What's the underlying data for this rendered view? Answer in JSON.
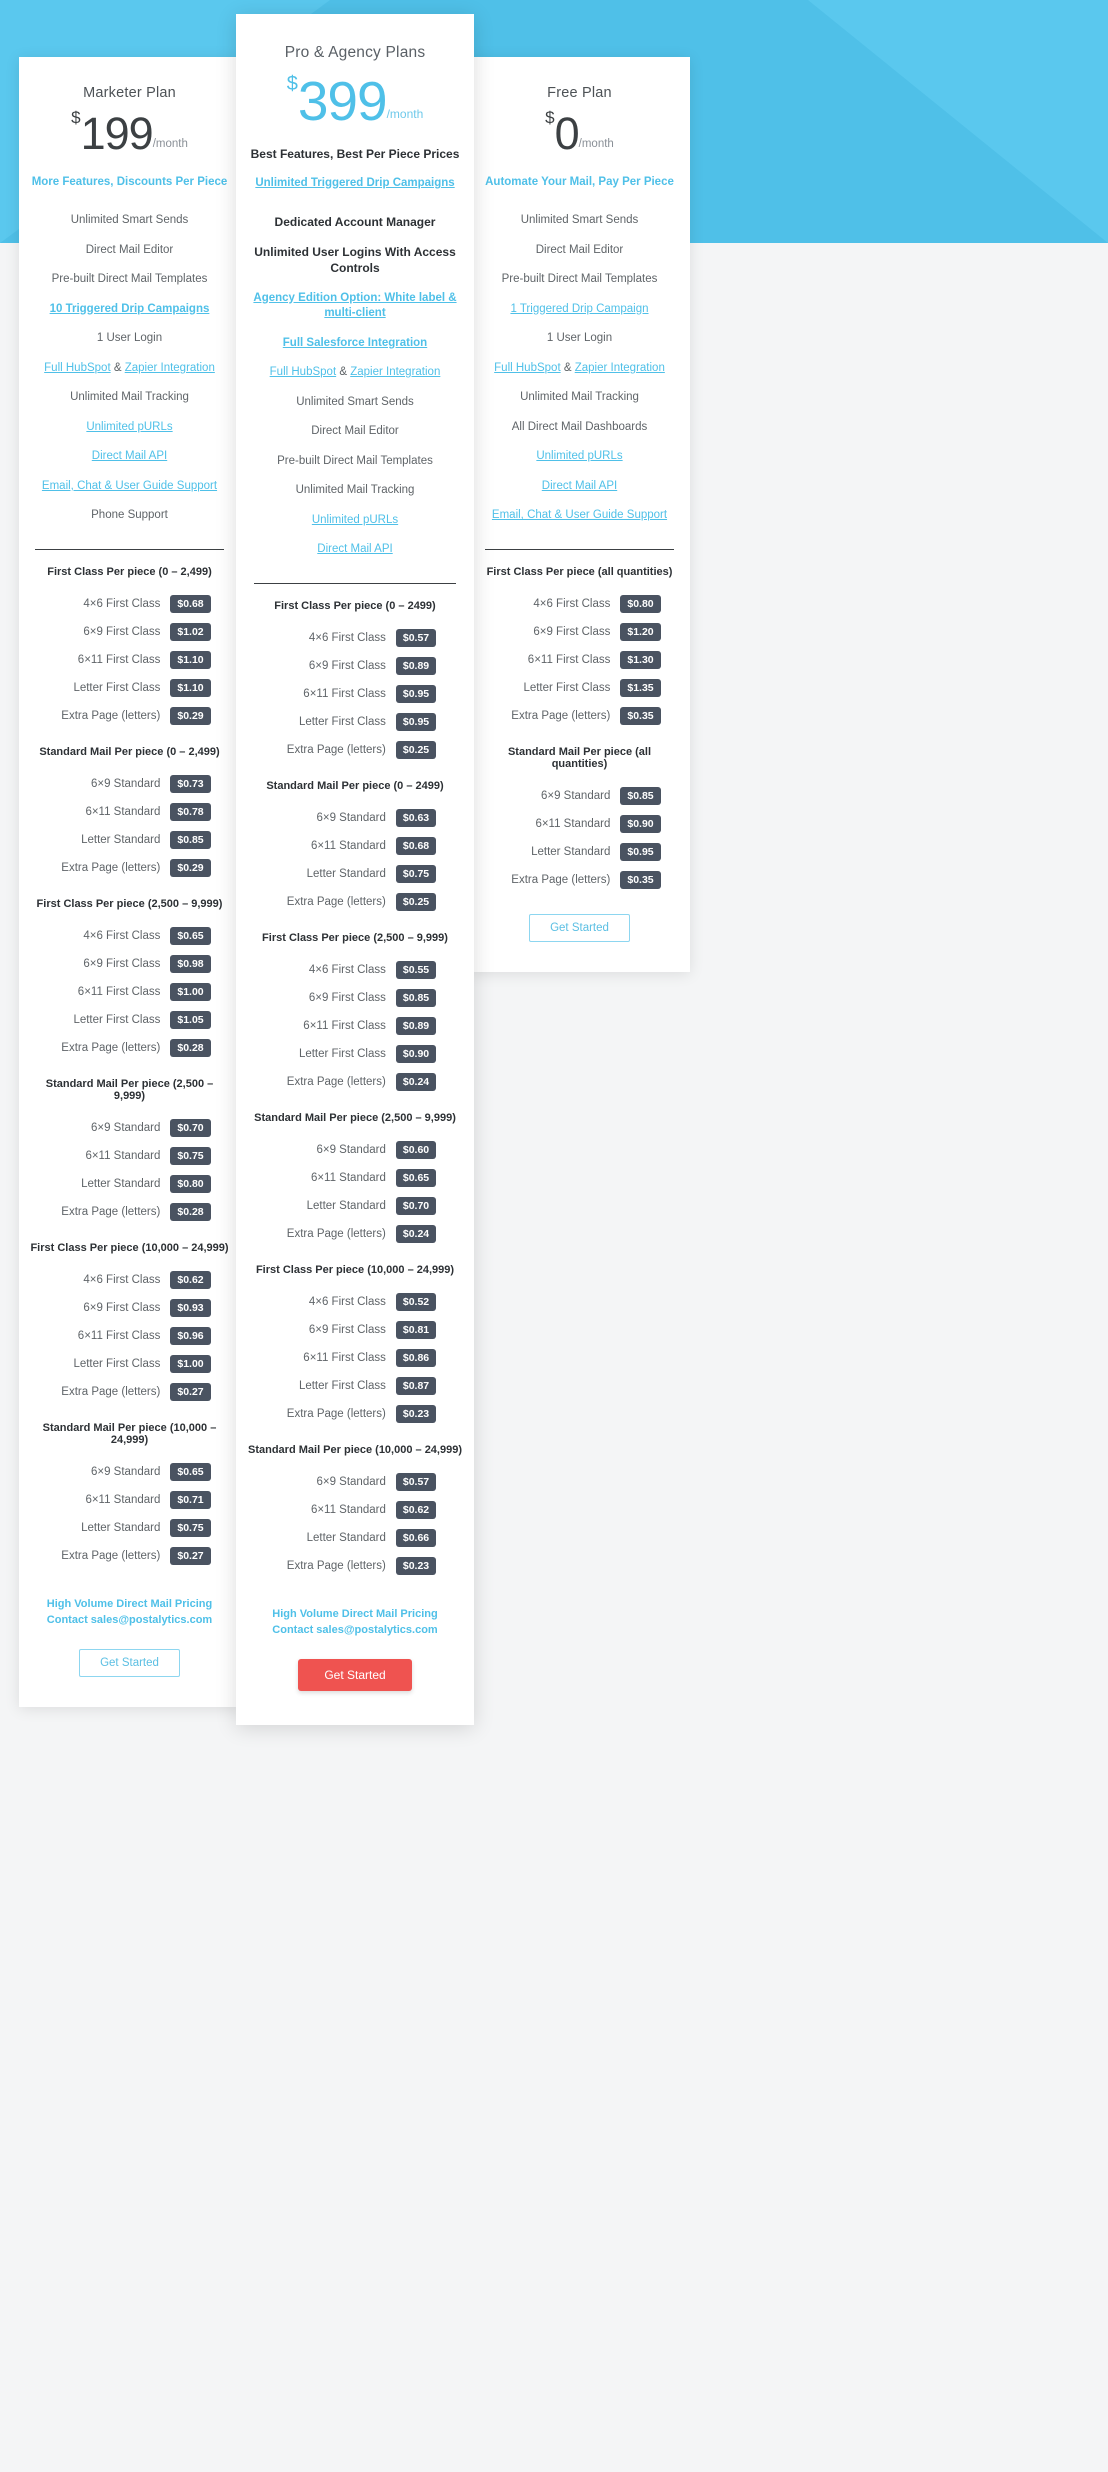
{
  "colors": {
    "banner": "#4fc0e8",
    "accent": "#4fc0e8",
    "badge": "#4a5361",
    "cta_solid": "#ef5350"
  },
  "marketer": {
    "plan_name": "Marketer Plan",
    "currency": "$",
    "amount": "199",
    "period": "/month",
    "tagline": "More Features, Discounts Per Piece",
    "features": [
      {
        "text": "Unlimited Smart Sends",
        "style": "plain"
      },
      {
        "text": "Direct Mail Editor",
        "style": "plain"
      },
      {
        "text": "Pre-built Direct Mail Templates",
        "style": "plain"
      },
      {
        "text": "10 Triggered Drip Campaigns",
        "style": "linkbold"
      },
      {
        "text": "1 User Login",
        "style": "plain"
      },
      {
        "text": "Full HubSpot & Zapier Integration",
        "style": "link-split"
      },
      {
        "text": "Unlimited Mail Tracking",
        "style": "plain"
      },
      {
        "text": "Unlimited pURLs",
        "style": "link"
      },
      {
        "text": "Direct Mail API",
        "style": "link"
      },
      {
        "text": "Email, Chat & User Guide Support",
        "style": "link"
      },
      {
        "text": "Phone Support",
        "style": "plain"
      }
    ],
    "tiers": [
      {
        "title": "First Class Per piece (0 – 2,499)",
        "rows": [
          {
            "label": "4×6 First Class",
            "price": "$0.68"
          },
          {
            "label": "6×9 First Class",
            "price": "$1.02"
          },
          {
            "label": "6×11 First Class",
            "price": "$1.10"
          },
          {
            "label": "Letter First Class",
            "price": "$1.10"
          },
          {
            "label": "Extra Page (letters)",
            "price": "$0.29"
          }
        ]
      },
      {
        "title": "Standard Mail Per piece (0 – 2,499)",
        "rows": [
          {
            "label": "6×9 Standard",
            "price": "$0.73"
          },
          {
            "label": "6×11 Standard",
            "price": "$0.78"
          },
          {
            "label": "Letter Standard",
            "price": "$0.85"
          },
          {
            "label": "Extra Page (letters)",
            "price": "$0.29"
          }
        ]
      },
      {
        "title": "First Class Per piece (2,500 – 9,999)",
        "rows": [
          {
            "label": "4×6 First Class",
            "price": "$0.65"
          },
          {
            "label": "6×9 First Class",
            "price": "$0.98"
          },
          {
            "label": "6×11 First Class",
            "price": "$1.00"
          },
          {
            "label": "Letter First Class",
            "price": "$1.05"
          },
          {
            "label": "Extra Page (letters)",
            "price": "$0.28"
          }
        ]
      },
      {
        "title": "Standard Mail Per piece (2,500 – 9,999)",
        "rows": [
          {
            "label": "6×9 Standard",
            "price": "$0.70"
          },
          {
            "label": "6×11 Standard",
            "price": "$0.75"
          },
          {
            "label": "Letter Standard",
            "price": "$0.80"
          },
          {
            "label": "Extra Page (letters)",
            "price": "$0.28"
          }
        ]
      },
      {
        "title": "First Class Per piece (10,000 – 24,999)",
        "rows": [
          {
            "label": "4×6 First Class",
            "price": "$0.62"
          },
          {
            "label": "6×9 First Class",
            "price": "$0.93"
          },
          {
            "label": "6×11 First Class",
            "price": "$0.96"
          },
          {
            "label": "Letter First Class",
            "price": "$1.00"
          },
          {
            "label": "Extra Page (letters)",
            "price": "$0.27"
          }
        ]
      },
      {
        "title": "Standard Mail Per piece (10,000 – 24,999)",
        "rows": [
          {
            "label": "6×9 Standard",
            "price": "$0.65"
          },
          {
            "label": "6×11 Standard",
            "price": "$0.71"
          },
          {
            "label": "Letter Standard",
            "price": "$0.75"
          },
          {
            "label": "Extra Page (letters)",
            "price": "$0.27"
          }
        ]
      }
    ],
    "contact_line1": "High Volume Direct Mail Pricing",
    "contact_line2": "Contact sales@postalytics.com",
    "cta_label": "Get Started"
  },
  "pro": {
    "plan_name": "Pro & Agency Plans",
    "currency": "$",
    "amount": "399",
    "period": "/month",
    "subhead": "Best Features, Best Per Piece Prices",
    "tagline": "Unlimited Triggered Drip Campaigns",
    "features": [
      {
        "text": "Dedicated Account Manager",
        "style": "bold"
      },
      {
        "text": "Unlimited User Logins With Access Controls",
        "style": "bold"
      },
      {
        "text": "Agency Edition Option: White label & multi-client",
        "style": "linkbold"
      },
      {
        "text": "Full Salesforce Integration",
        "style": "linkbold"
      },
      {
        "text": "Full HubSpot & Zapier Integration",
        "style": "link-split"
      },
      {
        "text": "Unlimited Smart Sends",
        "style": "plain"
      },
      {
        "text": "Direct Mail Editor",
        "style": "plain"
      },
      {
        "text": "Pre-built Direct Mail Templates",
        "style": "plain"
      },
      {
        "text": "Unlimited Mail Tracking",
        "style": "plain"
      },
      {
        "text": "Unlimited pURLs",
        "style": "link"
      },
      {
        "text": "Direct Mail API",
        "style": "link"
      }
    ],
    "tiers": [
      {
        "title": "First Class Per piece (0 – 2499)",
        "rows": [
          {
            "label": "4×6 First Class",
            "price": "$0.57"
          },
          {
            "label": "6×9 First Class",
            "price": "$0.89"
          },
          {
            "label": "6×11 First Class",
            "price": "$0.95"
          },
          {
            "label": "Letter First Class",
            "price": "$0.95"
          },
          {
            "label": "Extra Page (letters)",
            "price": "$0.25"
          }
        ]
      },
      {
        "title": "Standard Mail Per piece (0 – 2499)",
        "rows": [
          {
            "label": "6×9 Standard",
            "price": "$0.63"
          },
          {
            "label": "6×11 Standard",
            "price": "$0.68"
          },
          {
            "label": "Letter Standard",
            "price": "$0.75"
          },
          {
            "label": "Extra Page (letters)",
            "price": "$0.25"
          }
        ]
      },
      {
        "title": "First Class Per piece (2,500 – 9,999)",
        "rows": [
          {
            "label": "4×6 First Class",
            "price": "$0.55"
          },
          {
            "label": "6×9 First Class",
            "price": "$0.85"
          },
          {
            "label": "6×11 First Class",
            "price": "$0.89"
          },
          {
            "label": "Letter First Class",
            "price": "$0.90"
          },
          {
            "label": "Extra Page (letters)",
            "price": "$0.24"
          }
        ]
      },
      {
        "title": "Standard Mail Per piece (2,500 – 9,999)",
        "rows": [
          {
            "label": "6×9 Standard",
            "price": "$0.60"
          },
          {
            "label": "6×11 Standard",
            "price": "$0.65"
          },
          {
            "label": "Letter Standard",
            "price": "$0.70"
          },
          {
            "label": "Extra Page (letters)",
            "price": "$0.24"
          }
        ]
      },
      {
        "title": "First Class Per piece (10,000 – 24,999)",
        "rows": [
          {
            "label": "4×6 First Class",
            "price": "$0.52"
          },
          {
            "label": "6×9 First Class",
            "price": "$0.81"
          },
          {
            "label": "6×11 First Class",
            "price": "$0.86"
          },
          {
            "label": "Letter First Class",
            "price": "$0.87"
          },
          {
            "label": "Extra Page (letters)",
            "price": "$0.23"
          }
        ]
      },
      {
        "title": "Standard Mail Per piece (10,000 – 24,999)",
        "rows": [
          {
            "label": "6×9 Standard",
            "price": "$0.57"
          },
          {
            "label": "6×11 Standard",
            "price": "$0.62"
          },
          {
            "label": "Letter Standard",
            "price": "$0.66"
          },
          {
            "label": "Extra Page (letters)",
            "price": "$0.23"
          }
        ]
      }
    ],
    "contact_line1": "High Volume Direct Mail Pricing",
    "contact_line2": "Contact sales@postalytics.com",
    "cta_label": "Get Started"
  },
  "free": {
    "plan_name": "Free Plan",
    "currency": "$",
    "amount": "0",
    "period": "/month",
    "tagline": "Automate Your Mail, Pay Per Piece",
    "features": [
      {
        "text": "Unlimited Smart Sends",
        "style": "plain"
      },
      {
        "text": "Direct Mail Editor",
        "style": "plain"
      },
      {
        "text": "Pre-built Direct Mail Templates",
        "style": "plain"
      },
      {
        "text": "1 Triggered Drip Campaign",
        "style": "link"
      },
      {
        "text": "1 User Login",
        "style": "plain"
      },
      {
        "text": "Full HubSpot & Zapier Integration",
        "style": "link-split"
      },
      {
        "text": "Unlimited Mail Tracking",
        "style": "plain"
      },
      {
        "text": "All Direct Mail Dashboards",
        "style": "plain"
      },
      {
        "text": "Unlimited pURLs",
        "style": "link"
      },
      {
        "text": "Direct Mail API",
        "style": "link"
      },
      {
        "text": "Email, Chat & User Guide Support",
        "style": "link"
      }
    ],
    "tiers": [
      {
        "title": "First Class Per piece (all quantities)",
        "rows": [
          {
            "label": "4×6 First Class",
            "price": "$0.80"
          },
          {
            "label": "6×9 First Class",
            "price": "$1.20"
          },
          {
            "label": "6×11 First Class",
            "price": "$1.30"
          },
          {
            "label": "Letter First Class",
            "price": "$1.35"
          },
          {
            "label": "Extra Page (letters)",
            "price": "$0.35"
          }
        ]
      },
      {
        "title": "Standard Mail Per piece (all quantities)",
        "rows": [
          {
            "label": "6×9 Standard",
            "price": "$0.85"
          },
          {
            "label": "6×11 Standard",
            "price": "$0.90"
          },
          {
            "label": "Letter Standard",
            "price": "$0.95"
          },
          {
            "label": "Extra Page (letters)",
            "price": "$0.35"
          }
        ]
      }
    ],
    "cta_label": "Get Started"
  }
}
